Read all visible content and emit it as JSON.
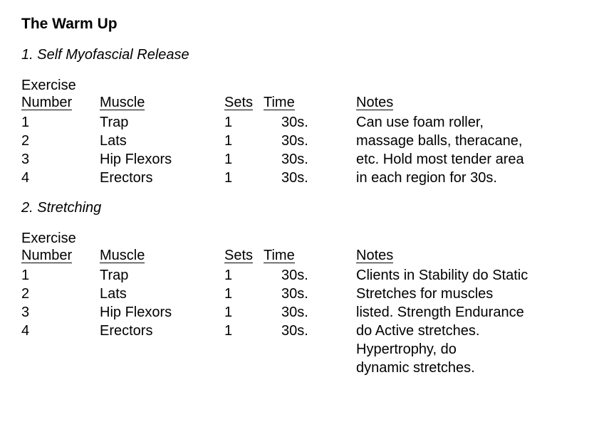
{
  "title": "The Warm Up",
  "sections": {
    "smr": {
      "heading": "1. Self Myofascial Release",
      "headers": {
        "number_top": "Exercise",
        "number": "Number",
        "muscle": "Muscle",
        "sets": "Sets",
        "time": "Time",
        "notes": "Notes"
      },
      "rows": {
        "r1": {
          "number": "1",
          "muscle": "Trap",
          "sets": "1",
          "time": "30s."
        },
        "r2": {
          "number": "2",
          "muscle": "Lats",
          "sets": "1",
          "time": "30s."
        },
        "r3": {
          "number": "3",
          "muscle": "Hip Flexors",
          "sets": "1",
          "time": "30s."
        },
        "r4": {
          "number": "4",
          "muscle": "Erectors",
          "sets": "1",
          "time": "30s."
        }
      },
      "notes_lines": {
        "l1": "Can use foam roller,",
        "l2": "massage balls, theracane,",
        "l3": "etc. Hold most tender area",
        "l4": "in each region for 30s."
      }
    },
    "stretch": {
      "heading": "2. Stretching",
      "headers": {
        "number_top": "Exercise",
        "number": "Number",
        "muscle": "Muscle",
        "sets": "Sets",
        "time": "Time",
        "notes": "Notes"
      },
      "rows": {
        "r1": {
          "number": "1",
          "muscle": "Trap",
          "sets": "1",
          "time": "30s."
        },
        "r2": {
          "number": "2",
          "muscle": "Lats",
          "sets": "1",
          "time": "30s."
        },
        "r3": {
          "number": "3",
          "muscle": "Hip Flexors",
          "sets": "1",
          "time": "30s."
        },
        "r4": {
          "number": "4",
          "muscle": "Erectors",
          "sets": "1",
          "time": "30s."
        }
      },
      "notes_lines": {
        "l1": "Clients in Stability do Static",
        "l2": "Stretches for muscles",
        "l3": "listed. Strength Endurance",
        "l4": "do Active stretches.",
        "l5": "Hypertrophy, do",
        "l6": "dynamic stretches."
      }
    }
  }
}
